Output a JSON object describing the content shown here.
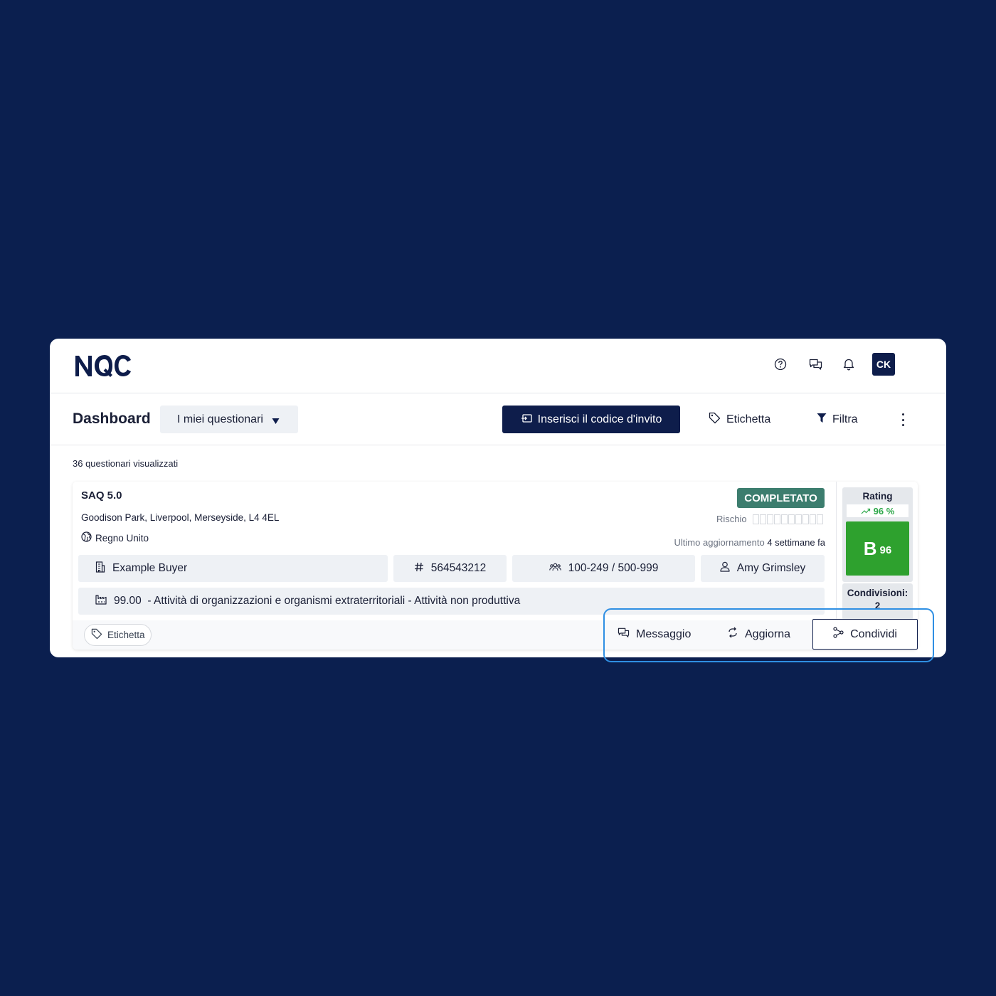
{
  "app": {
    "logo_text": "NQC",
    "avatar_initials": "CK"
  },
  "header_icons": [
    "help-icon",
    "chat-icon",
    "bell-icon"
  ],
  "toolbar": {
    "title": "Dashboard",
    "dropdown_value": "I miei questionari",
    "invite_label": "Inserisci il codice d'invito",
    "tag_label": "Etichetta",
    "filter_label": "Filtra"
  },
  "results_count": "36 questionari visualizzati",
  "card": {
    "title": "SAQ 5.0",
    "address": "Goodison Park, Liverpool, Merseyside, L4 4EL",
    "country": "Regno Unito",
    "status": "COMPLETATO",
    "risk_label": "Rischio",
    "updated_label": "Ultimo aggiornamento",
    "updated_value": "4 settimane fa",
    "buyer": "Example Buyer",
    "id_number": "564543212",
    "employees": "100-249 / 500-999",
    "contact": "Amy Grimsley",
    "activity": "99.00  - Attività di organizzazioni e organismi extraterritoriali - Attività non produttiva",
    "tag_label": "Etichetta",
    "rating": {
      "label": "Rating",
      "trend": "96 %",
      "grade": "B",
      "score": "96",
      "shares_label": "Condivisioni:",
      "shares_value": "2"
    }
  },
  "actions": {
    "message": "Messaggio",
    "refresh": "Aggiorna",
    "share": "Condividi"
  },
  "colors": {
    "background": "#0b1f4f",
    "brand_navy": "#0e1d4b",
    "status_green": "#3c7d6e",
    "grade_green": "#2ea12e",
    "highlight_blue": "#2f8fe3"
  }
}
